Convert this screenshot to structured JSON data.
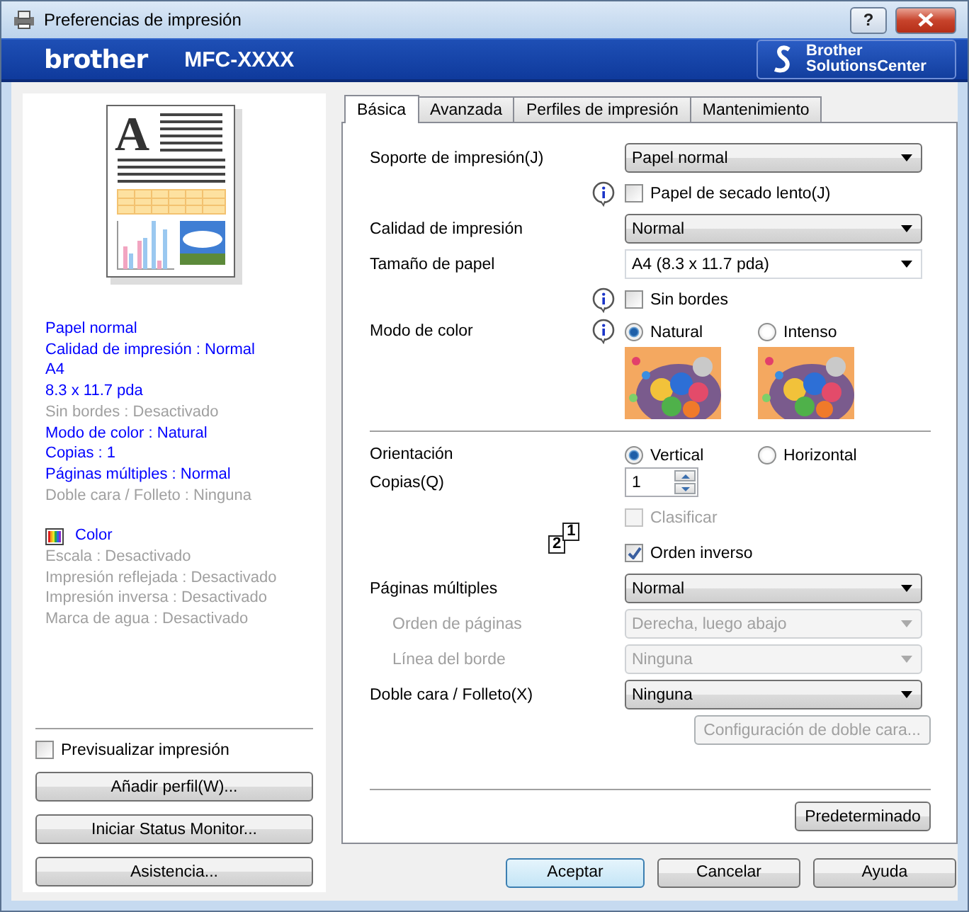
{
  "window": {
    "title": "Preferencias de impresión",
    "help_button": "?"
  },
  "brand": {
    "logo": "brother",
    "model": "MFC-XXXX",
    "solutions_center": [
      "Brother",
      "SolutionsCenter"
    ]
  },
  "preview": {
    "letter": "A"
  },
  "summary": [
    {
      "text": "Papel normal",
      "disabled": false
    },
    {
      "text": "Calidad de impresión : Normal",
      "disabled": false
    },
    {
      "text": "A4",
      "disabled": false
    },
    {
      "text": "8.3 x 11.7 pda",
      "disabled": false
    },
    {
      "text": "Sin bordes : Desactivado",
      "disabled": true
    },
    {
      "text": "Modo de color : Natural",
      "disabled": false
    },
    {
      "text": "Copias : 1",
      "disabled": false
    },
    {
      "text": "Páginas múltiples : Normal",
      "disabled": false
    },
    {
      "text": "Doble cara / Folleto : Ninguna",
      "disabled": true
    }
  ],
  "color_summary": {
    "label": "Color",
    "items": [
      {
        "text": "Escala : Desactivado",
        "disabled": true
      },
      {
        "text": "Impresión reflejada : Desactivado",
        "disabled": true
      },
      {
        "text": "Impresión inversa : Desactivado",
        "disabled": true
      },
      {
        "text": "Marca de agua : Desactivado",
        "disabled": true
      }
    ]
  },
  "preview_checkbox": {
    "label": "Previsualizar impresión",
    "checked": false
  },
  "side_buttons": [
    "Añadir perfil(W)...",
    "Iniciar Status Monitor...",
    "Asistencia..."
  ],
  "tabs": [
    {
      "label": "Básica",
      "selected": true
    },
    {
      "label": "Avanzada",
      "selected": false
    },
    {
      "label": "Perfiles de impresión",
      "selected": false
    },
    {
      "label": "Mantenimiento",
      "selected": false
    }
  ],
  "rows": [
    {
      "kind": "select",
      "label": "Soporte de impresión(J)",
      "value": "Papel normal",
      "disabled": false,
      "editable": false
    },
    {
      "kind": "checkbox",
      "label": "Papel de secado lento(J)",
      "checked": false,
      "disabled": false,
      "info": true
    },
    {
      "kind": "select",
      "label": "Calidad de impresión",
      "value": "Normal",
      "disabled": false,
      "editable": false
    },
    {
      "kind": "select",
      "label": "Tamaño de papel",
      "value": "A4 (8.3 x 11.7 pda)",
      "disabled": false,
      "editable": true
    },
    {
      "kind": "checkbox",
      "label": "Sin bordes",
      "checked": false,
      "disabled": false,
      "info": true
    },
    {
      "kind": "radio",
      "label": "Modo de color",
      "info": true,
      "options": [
        {
          "label": "Natural",
          "selected": true
        },
        {
          "label": "Intenso",
          "selected": false
        }
      ]
    },
    {
      "kind": "divider"
    },
    {
      "kind": "radio",
      "label": "Orientación",
      "info": false,
      "options": [
        {
          "label": "Vertical",
          "selected": true
        },
        {
          "label": "Horizontal",
          "selected": false
        }
      ]
    },
    {
      "kind": "spinner",
      "label": "Copias(Q)",
      "value": "1"
    },
    {
      "kind": "checkbox",
      "label": "Clasificar",
      "checked": false,
      "disabled": true,
      "info": false
    },
    {
      "kind": "checkbox",
      "label": "Orden inverso",
      "checked": true,
      "disabled": false,
      "info": false,
      "order_icon": [
        "2",
        "1"
      ]
    },
    {
      "kind": "select",
      "label": "Páginas múltiples",
      "value": "Normal",
      "disabled": false,
      "editable": false,
      "children": [
        {
          "kind": "select",
          "label": "Orden de páginas",
          "value": "Derecha, luego abajo",
          "disabled": true,
          "editable": false
        },
        {
          "kind": "select",
          "label": "Línea del borde",
          "value": "Ninguna",
          "disabled": true,
          "editable": false
        }
      ]
    },
    {
      "kind": "select",
      "label": "Doble cara / Folleto(X)",
      "value": "Ninguna",
      "disabled": false,
      "editable": false
    },
    {
      "kind": "button",
      "label": "Configuración de doble cara...",
      "disabled": true
    }
  ],
  "default_button": "Predeterminado",
  "dialog_buttons": [
    {
      "label": "Aceptar",
      "default": true
    },
    {
      "label": "Cancelar",
      "default": false
    },
    {
      "label": "Ayuda",
      "default": false
    }
  ]
}
